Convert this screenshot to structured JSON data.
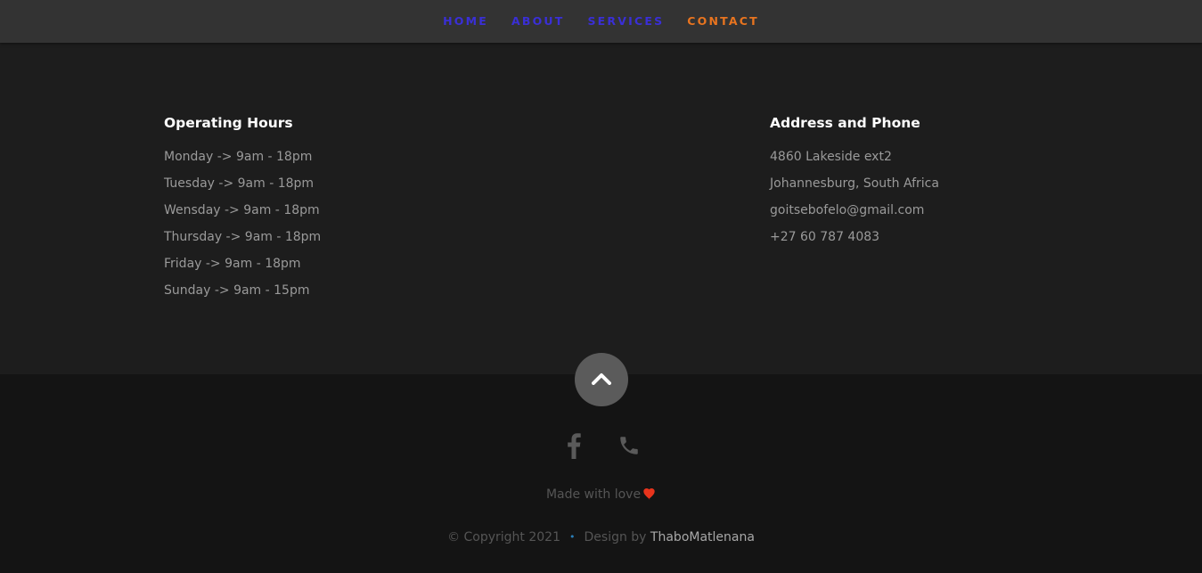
{
  "nav": {
    "items": [
      {
        "label": "HOME",
        "active": false
      },
      {
        "label": "ABOUT",
        "active": false
      },
      {
        "label": "SERVICES",
        "active": false
      },
      {
        "label": "CONTACT",
        "active": true
      }
    ],
    "link_color": "#3a2fd6",
    "active_color": "#e8741f"
  },
  "hours": {
    "title": "Operating Hours",
    "lines": [
      "Monday -> 9am - 18pm",
      "Tuesday -> 9am - 18pm",
      "Wensday -> 9am - 18pm",
      "Thursday -> 9am - 18pm",
      "Friday -> 9am - 18pm",
      "Sunday -> 9am - 15pm"
    ]
  },
  "address": {
    "title": "Address and Phone",
    "lines": [
      "4860 Lakeside ext2",
      "Johannesburg, South Africa",
      "goitsebofelo@gmail.com",
      "+27 60 787 4083"
    ]
  },
  "footer": {
    "back_to_top_icon": "chevron-up-icon",
    "social_icons": [
      "facebook-icon",
      "phone-icon"
    ],
    "made_with": "Made with love",
    "heart_color": "#e8341c",
    "copyright": "© Copyright 2021",
    "separator": "•",
    "design_by": "Design by",
    "designer": "ThaboMatlenana"
  }
}
